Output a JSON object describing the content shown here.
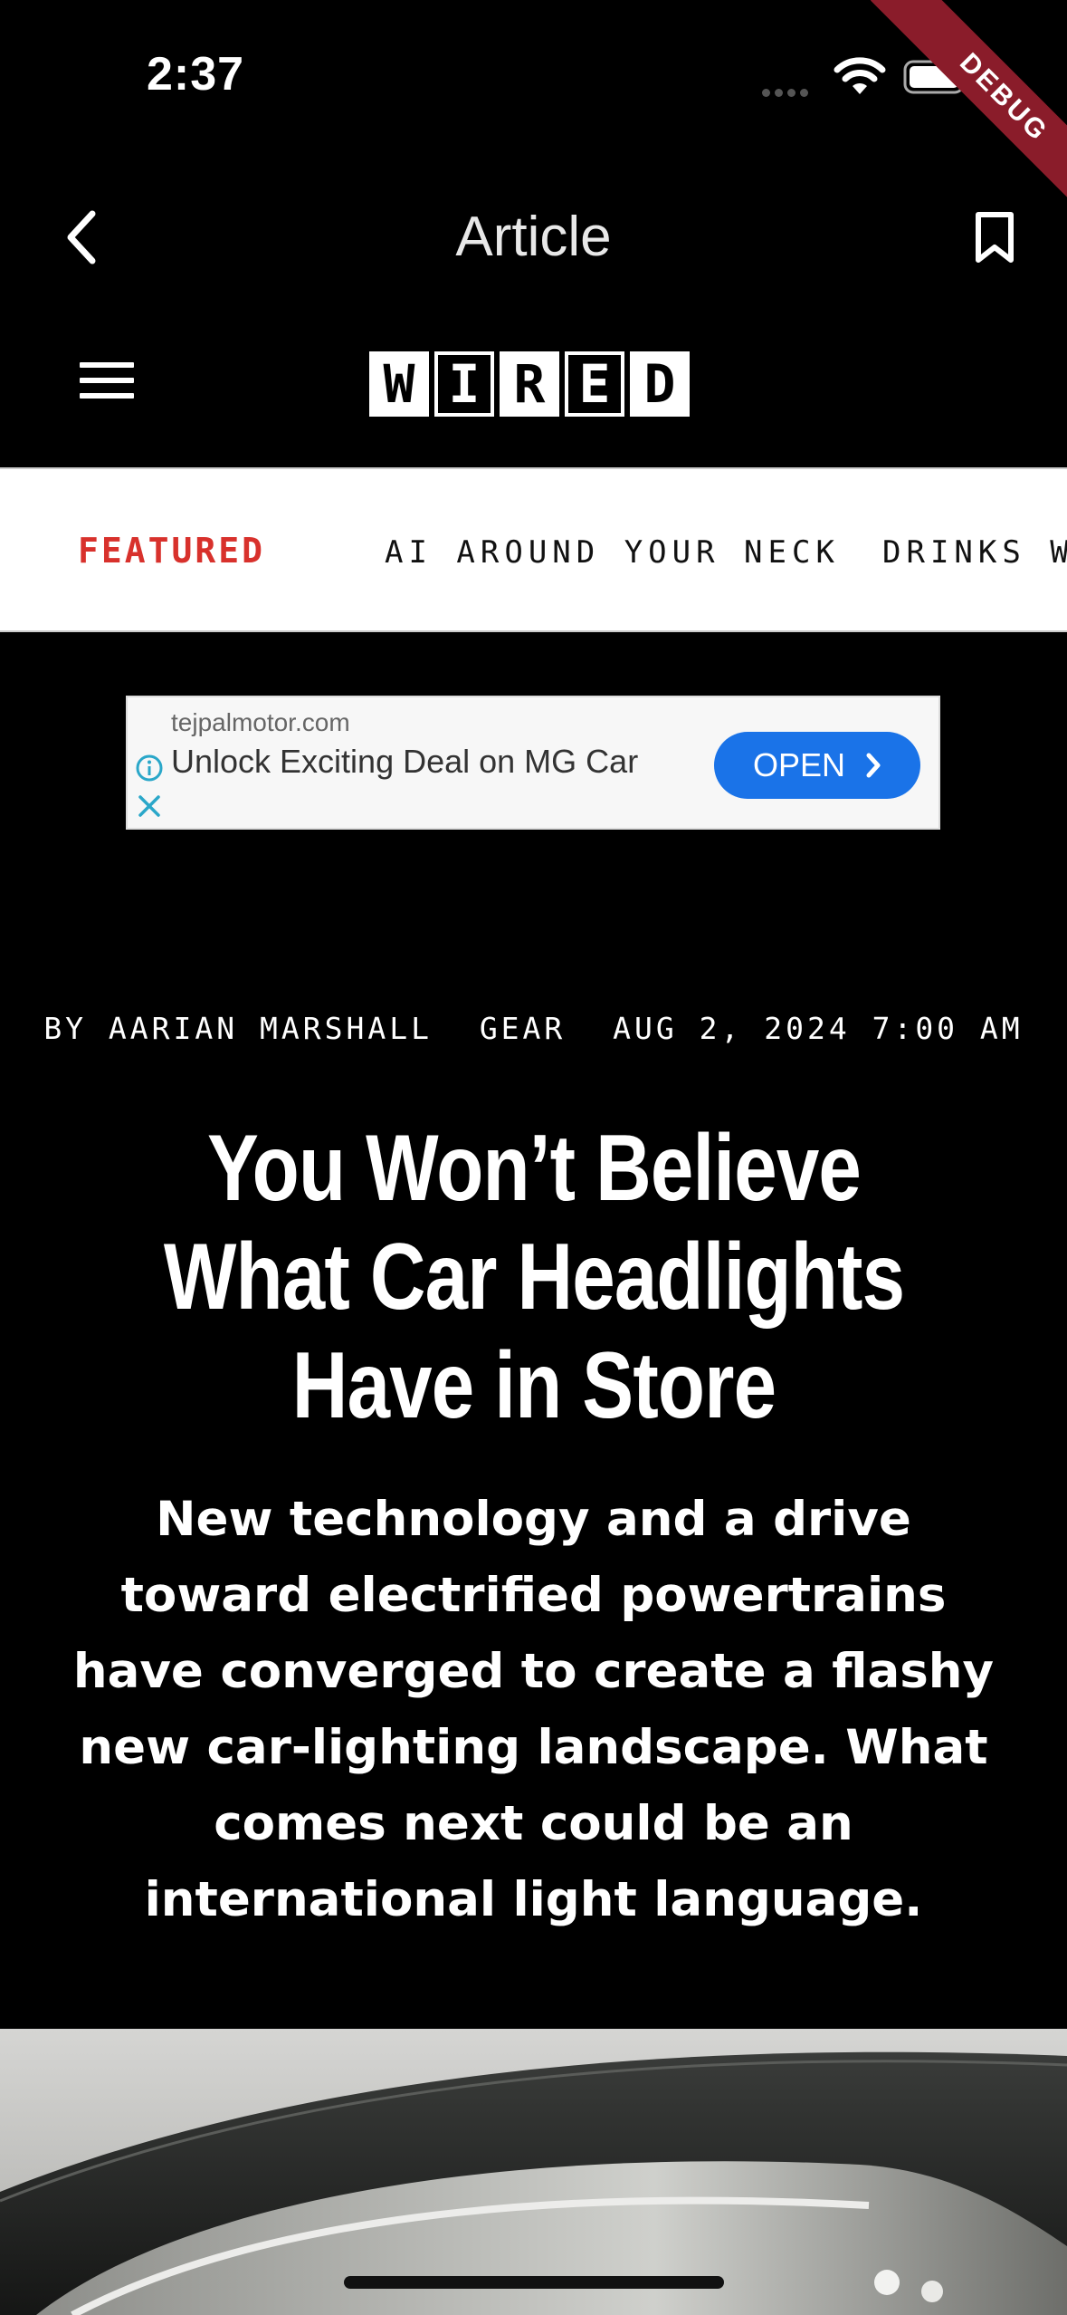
{
  "status_bar": {
    "time": "2:37"
  },
  "debug_banner": "DEBUG",
  "nav": {
    "title": "Article"
  },
  "logo": {
    "letters": [
      "W",
      "I",
      "R",
      "E",
      "D"
    ]
  },
  "ticker": {
    "items": [
      "FEATURED",
      "AI AROUND YOUR NECK",
      "DRINKS WI"
    ]
  },
  "ad": {
    "domain": "tejpalmotor.com",
    "headline": "Unlock Exciting Deal on MG Car",
    "cta": "OPEN"
  },
  "article": {
    "byline": "BY AARIAN MARSHALL",
    "section": "GEAR",
    "date": "AUG 2, 2024 7:00 AM",
    "headline": "You Won’t Believe What Car Headlights Have in Store",
    "dek": "New technology and a drive toward electrified powertrains have converged to create a flashy new car-lighting landscape. What comes next could be an international light language."
  },
  "icons": {
    "back": "chevron-left-icon",
    "bookmark": "bookmark-icon",
    "menu": "hamburger-menu-icon",
    "wifi": "wifi-icon",
    "battery": "battery-icon",
    "ad_info": "info-icon",
    "ad_close": "close-icon",
    "ad_cta": "chevron-right-icon"
  },
  "colors": {
    "background": "#000000",
    "featured": "#d8312c",
    "ad_button": "#1a73e8",
    "debug_ribbon": "#8a1c2a"
  }
}
